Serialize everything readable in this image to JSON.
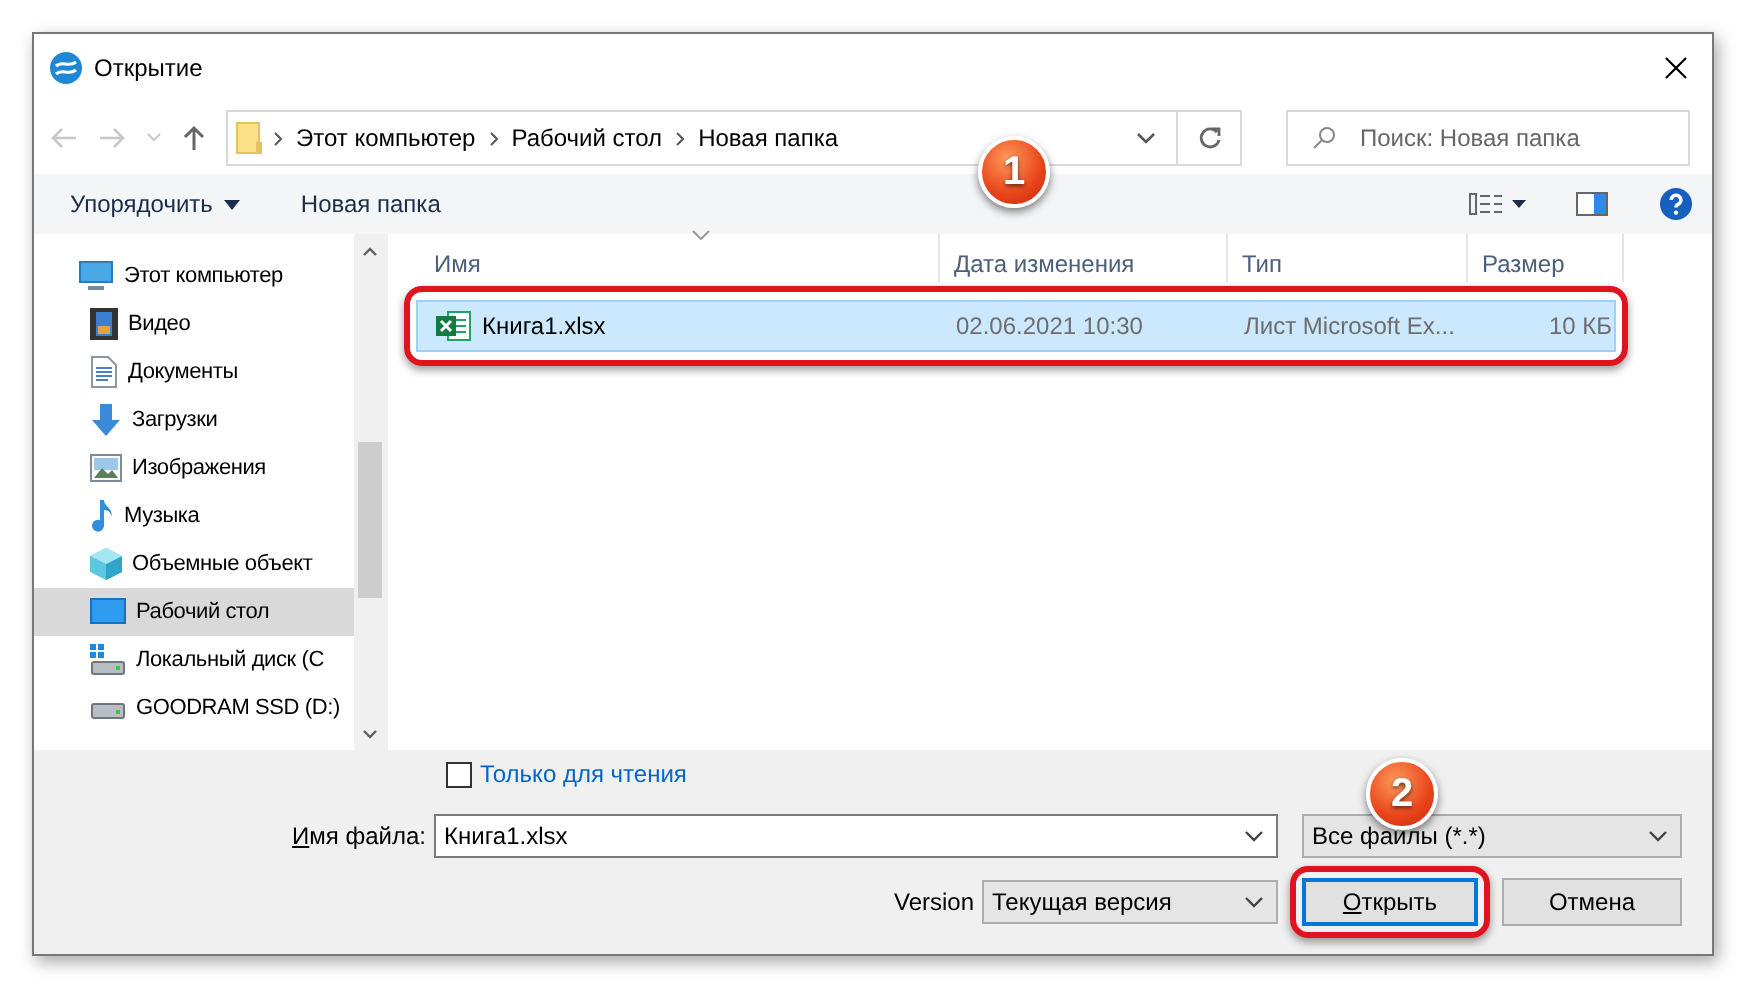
{
  "window": {
    "title": "Открытие"
  },
  "address": {
    "breadcrumbs": [
      "Этот компьютер",
      "Рабочий стол",
      "Новая папка"
    ]
  },
  "search": {
    "placeholder": "Поиск: Новая папка"
  },
  "toolbar": {
    "organize": "Упорядочить",
    "new_folder": "Новая папка"
  },
  "sidebar": {
    "items": [
      {
        "label": "Этот компьютер",
        "kind": "computer",
        "selected": false,
        "children": [
          {
            "label": "Видео",
            "kind": "video",
            "selected": false
          },
          {
            "label": "Документы",
            "kind": "documents",
            "selected": false
          },
          {
            "label": "Загрузки",
            "kind": "downloads",
            "selected": false
          },
          {
            "label": "Изображения",
            "kind": "pictures",
            "selected": false
          },
          {
            "label": "Музыка",
            "kind": "music",
            "selected": false
          },
          {
            "label": "Объемные объект",
            "kind": "objects",
            "selected": false
          },
          {
            "label": "Рабочий стол",
            "kind": "desktop",
            "selected": true
          },
          {
            "label": "Локальный диск (C",
            "kind": "system-disk",
            "selected": false
          },
          {
            "label": "GOODRAM SSD (D:)",
            "kind": "disk",
            "selected": false
          }
        ]
      }
    ]
  },
  "table": {
    "columns": [
      "Имя",
      "Дата изменения",
      "Тип",
      "Размер"
    ],
    "rows": [
      {
        "cells": [
          "Книга1.xlsx",
          "02.06.2021 10:30",
          "Лист Microsoft Ex...",
          "10 КБ"
        ],
        "selected": true
      }
    ]
  },
  "read_only": {
    "label": "Только для чтения",
    "checked": false
  },
  "file_name": {
    "label": "Имя файла:",
    "value": "Книга1.xlsx"
  },
  "file_type": {
    "value": "Все файлы (*.*)"
  },
  "version": {
    "label": "Version",
    "value": "Текущая версия"
  },
  "buttons": [
    {
      "label": "Открыть",
      "default": true
    },
    {
      "label": "Отмена",
      "default": false
    }
  ],
  "annotations": [
    {
      "label": "1"
    },
    {
      "label": "2"
    }
  ]
}
